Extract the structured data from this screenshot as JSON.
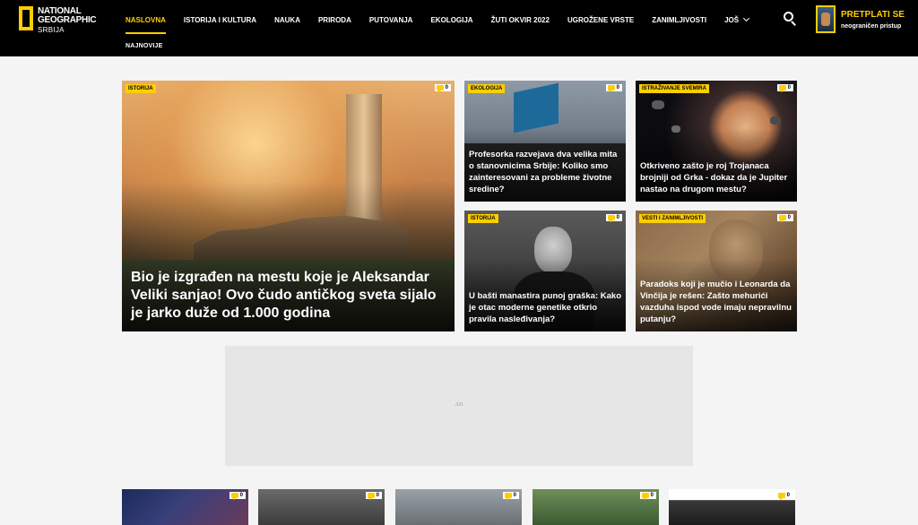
{
  "brand": {
    "line1": "NATIONAL",
    "line2": "GEOGRAPHIC",
    "sub": "SRBIJA",
    "accent": "#ffce00"
  },
  "nav": {
    "items": [
      "NASLOVNA",
      "ISTORIJA I KULTURA",
      "NAUKA",
      "PRIRODA",
      "PUTOVANJA",
      "EKOLOGIJA",
      "ŽUTI OKVIR 2022",
      "UGROŽENE VRSTE",
      "ZANIMLJIVOSTI",
      "JOŠ"
    ],
    "active": "NASLOVNA",
    "subnav": "NAJNOVIJE"
  },
  "header": {
    "search_icon": "search-icon",
    "subscribe_title": "PRETPLATI SE",
    "subscribe_subtitle": "neograničen pristup"
  },
  "featured": {
    "big": {
      "tag": "ISTORIJA",
      "comments": "0",
      "headline": "Bio je izgrađen na mestu koje je Aleksandar Veliki sanjao! Ovo čudo antičkog sveta sijalo je jarko duže od 1.000 godina"
    },
    "cards": [
      {
        "tag": "EKOLOGIJA",
        "comments": "0",
        "headline": "Profesorka razvejava dva velika mita o stanovnicima Srbije: Koliko smo zainteresovani za probleme životne sredine?"
      },
      {
        "tag": "ISTRAŽIVANJE SVEMIRA",
        "comments": "0",
        "headline": "Otkriveno zašto je roj Trojanaca brojniji od Grka - dokaz da je Jupiter nastao na drugom mestu?"
      },
      {
        "tag": "ISTORIJA",
        "comments": "0",
        "headline": "U bašti manastira punoj graška: Kako je otac moderne genetike otkrio pravila nasleđivanja?"
      },
      {
        "tag": "VESTI I ZANIMLJIVOSTI",
        "comments": "0",
        "headline": "Paradoks koji je mučio i Leonarda da Vinčija je rešen: Zašto mehurići vazduha ispod vode imaju nepravilnu putanju?"
      }
    ]
  },
  "ad": {
    "label": "AD"
  },
  "bottom_row": {
    "comments": [
      "0",
      "0",
      "0",
      "0",
      "0"
    ]
  }
}
